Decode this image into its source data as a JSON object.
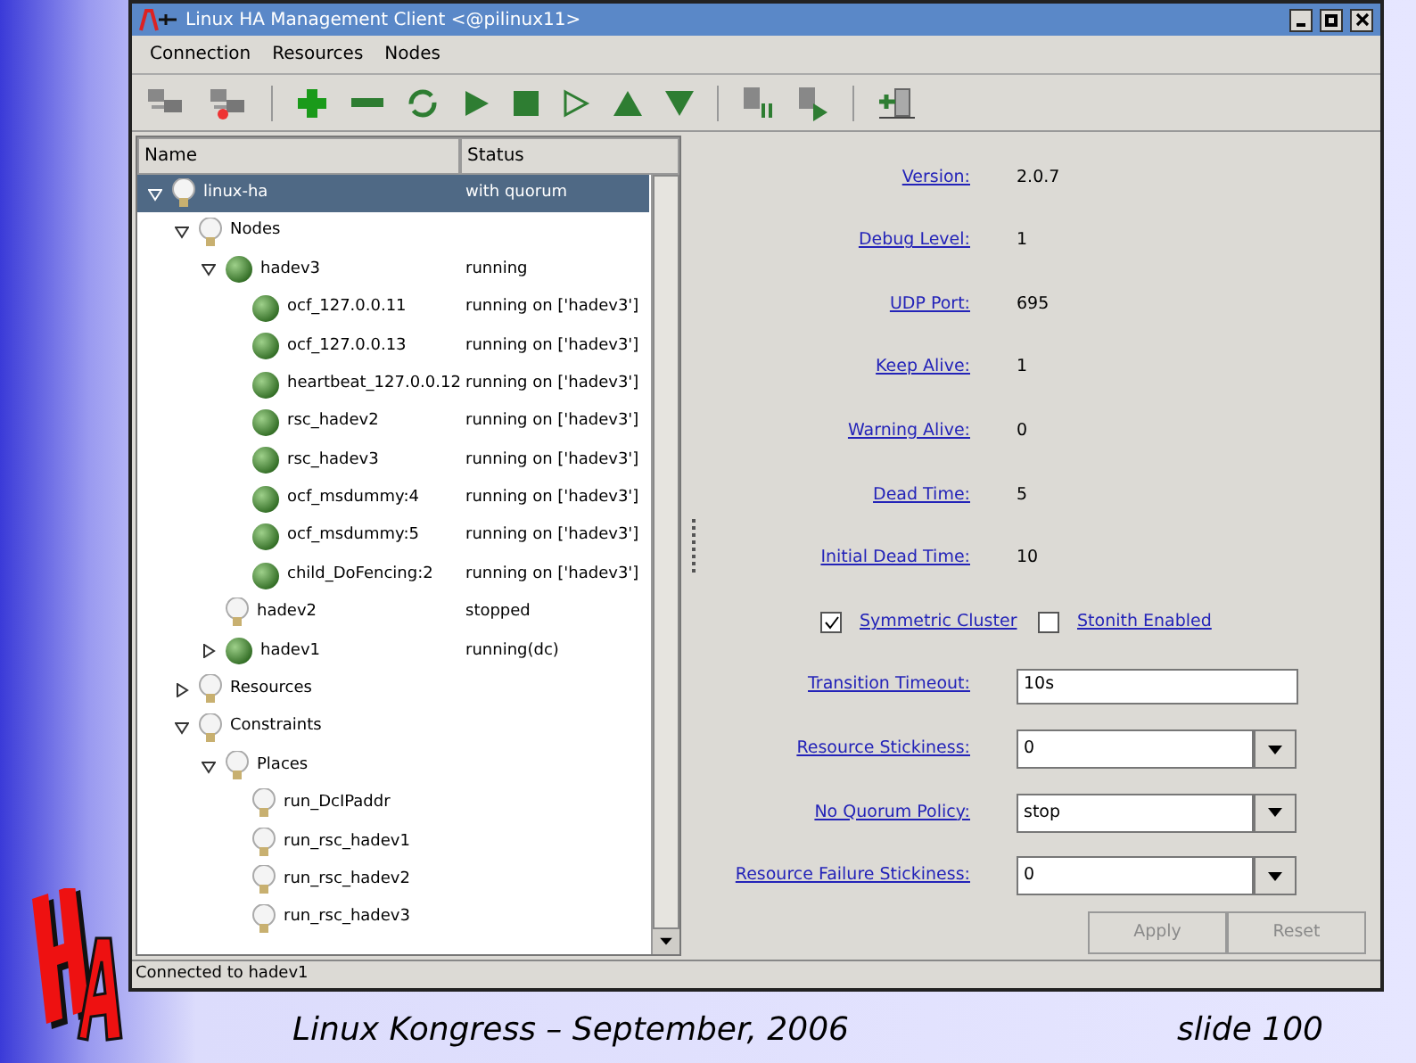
{
  "window": {
    "title": "Linux HA Management Client <@pilinux11>"
  },
  "menu": [
    "Connection",
    "Resources",
    "Nodes"
  ],
  "tree": {
    "columns": [
      "Name",
      "Status"
    ],
    "items": [
      {
        "name": "linux-ha",
        "status": "with quorum",
        "kind": "bulb",
        "expanded": true,
        "selected": true,
        "children": [
          {
            "name": "Nodes",
            "kind": "bulb",
            "expanded": true,
            "selected": false,
            "children": [
              {
                "name": "hadev3",
                "status": "running",
                "kind": "ball",
                "expanded": true,
                "selected": false,
                "children": [
                  {
                    "name": "ocf_127.0.0.11",
                    "status": "running on ['hadev3']",
                    "kind": "ball",
                    "selected": false
                  },
                  {
                    "name": "ocf_127.0.0.13",
                    "status": "running on ['hadev3']",
                    "kind": "ball",
                    "selected": false
                  },
                  {
                    "name": "heartbeat_127.0.0.12",
                    "status": "running on ['hadev3']",
                    "kind": "ball",
                    "selected": false
                  },
                  {
                    "name": "rsc_hadev2",
                    "status": "running on ['hadev3']",
                    "kind": "ball",
                    "selected": false
                  },
                  {
                    "name": "rsc_hadev3",
                    "status": "running on ['hadev3']",
                    "kind": "ball",
                    "selected": false
                  },
                  {
                    "name": "ocf_msdummy:4",
                    "status": "running on ['hadev3']",
                    "kind": "ball",
                    "selected": false
                  },
                  {
                    "name": "ocf_msdummy:5",
                    "status": "running on ['hadev3']",
                    "kind": "ball",
                    "selected": false
                  },
                  {
                    "name": "child_DoFencing:2",
                    "status": "running on ['hadev3']",
                    "kind": "ball",
                    "selected": false
                  }
                ]
              },
              {
                "name": "hadev2",
                "status": "stopped",
                "kind": "bulb",
                "selected": false
              },
              {
                "name": "hadev1",
                "status": "running(dc)",
                "kind": "ball",
                "expanded": false,
                "selected": false
              }
            ]
          },
          {
            "name": "Resources",
            "kind": "bulb",
            "expanded": false,
            "selected": false
          },
          {
            "name": "Constraints",
            "kind": "bulb",
            "expanded": true,
            "selected": false,
            "children": [
              {
                "name": "Places",
                "kind": "bulb",
                "expanded": true,
                "selected": false,
                "children": [
                  {
                    "name": "run_DcIPaddr",
                    "kind": "bulb",
                    "selected": false
                  },
                  {
                    "name": "run_rsc_hadev1",
                    "kind": "bulb",
                    "selected": false
                  },
                  {
                    "name": "run_rsc_hadev2",
                    "kind": "bulb",
                    "selected": false
                  },
                  {
                    "name": "run_rsc_hadev3",
                    "kind": "bulb",
                    "selected": false
                  }
                ]
              }
            ]
          }
        ]
      }
    ]
  },
  "form": [
    {
      "kind": "text",
      "label": "Version:",
      "value": "2.0.7"
    },
    {
      "kind": "text",
      "label": "Debug Level:",
      "value": "1"
    },
    {
      "kind": "text",
      "label": "UDP Port:",
      "value": "695"
    },
    {
      "kind": "text",
      "label": "Keep Alive:",
      "value": "1"
    },
    {
      "kind": "text",
      "label": "Warning Alive:",
      "value": "0"
    },
    {
      "kind": "text",
      "label": "Dead Time:",
      "value": "5"
    },
    {
      "kind": "text",
      "label": "Initial Dead Time:",
      "value": "10"
    },
    {
      "kind": "checks",
      "items": [
        {
          "label": "Symmetric Cluster",
          "checked": true
        },
        {
          "label": "Stonith Enabled",
          "checked": false
        }
      ]
    },
    {
      "kind": "input",
      "label": "Transition Timeout:",
      "value": "10s"
    },
    {
      "kind": "combo",
      "label": "Resource Stickiness:",
      "value": "0"
    },
    {
      "kind": "combo",
      "label": "No Quorum Policy:",
      "value": "stop"
    },
    {
      "kind": "combo",
      "label": "Resource Failure Stickiness:",
      "value": "0"
    }
  ],
  "buttons": [
    {
      "label": "Apply",
      "disabled": true
    },
    {
      "label": "Reset",
      "disabled": true
    }
  ],
  "status_bar": "Connected to hadev1",
  "slide": {
    "footer": "Linux Kongress – September, 2006",
    "page": "slide 100"
  }
}
